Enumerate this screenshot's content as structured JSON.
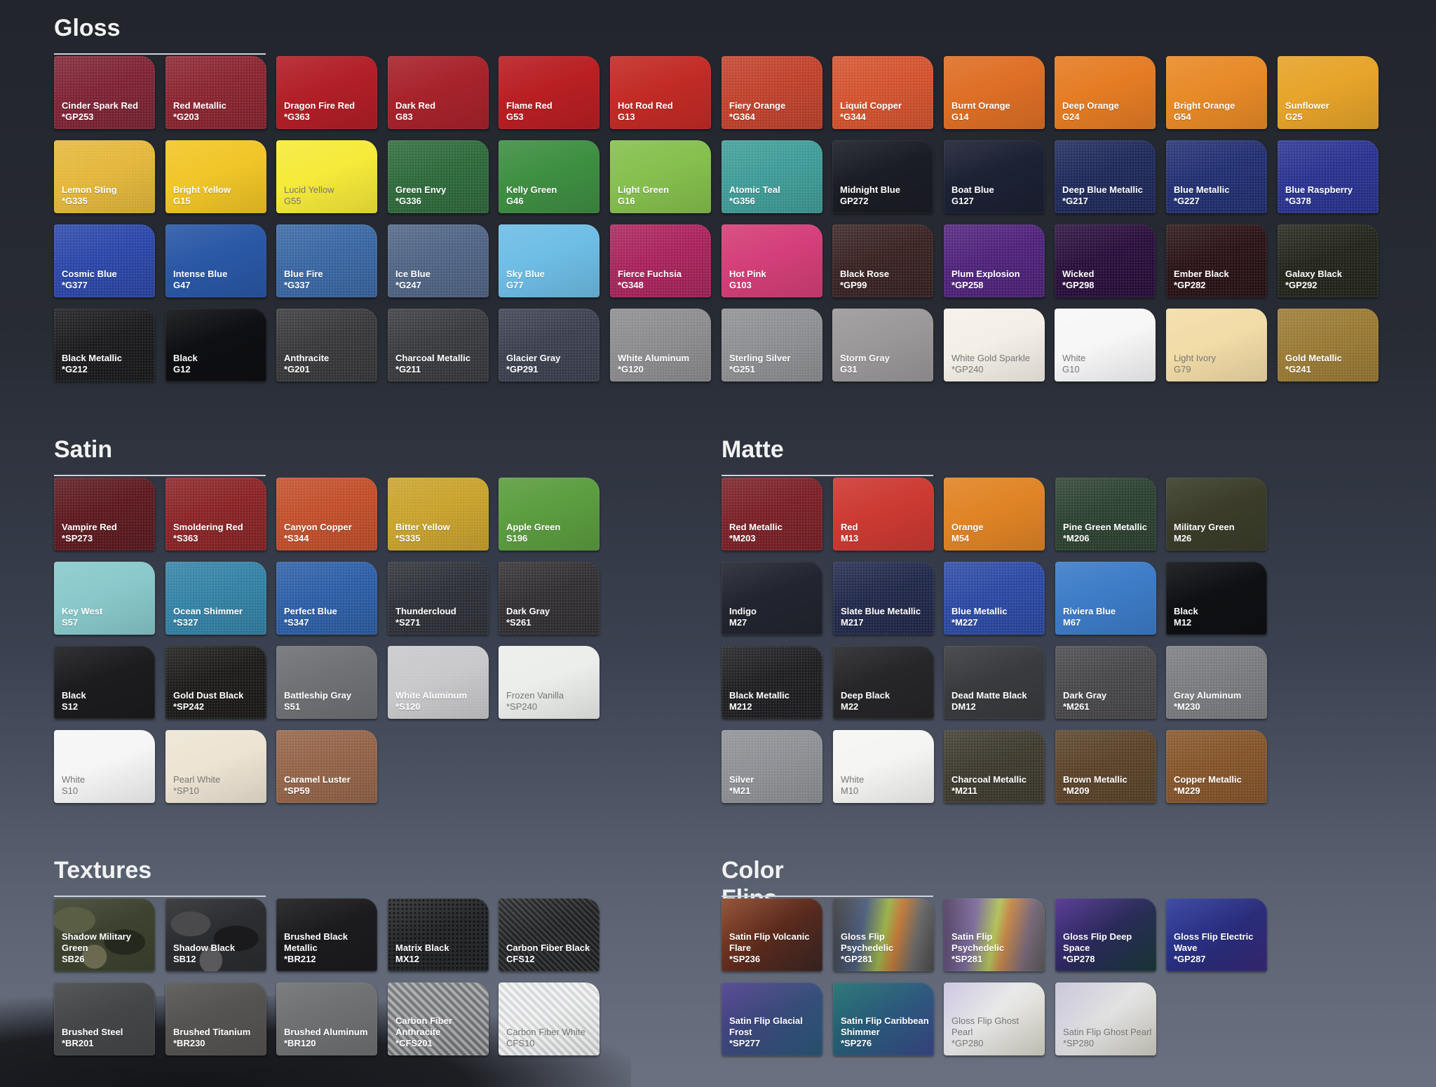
{
  "sections": [
    {
      "title": "Gloss",
      "swatches": [
        {
          "name": "Cinder Spark Red",
          "code": "*GP253",
          "color": "#7e2436",
          "texture": "metal"
        },
        {
          "name": "Red Metallic",
          "code": "*G203",
          "color": "#8a2530",
          "texture": "metal"
        },
        {
          "name": "Dragon Fire Red",
          "code": "*G363",
          "color": "#b21f27"
        },
        {
          "name": "Dark Red",
          "code": "G83",
          "color": "#a8232c"
        },
        {
          "name": "Flame Red",
          "code": "G53",
          "color": "#b91f23"
        },
        {
          "name": "Hot Rod Red",
          "code": "G13",
          "color": "#c32b26"
        },
        {
          "name": "Fiery Orange",
          "code": "*G364",
          "color": "#c0422c",
          "texture": "metal"
        },
        {
          "name": "Liquid Copper",
          "code": "*G344",
          "color": "#d3532e",
          "texture": "metal"
        },
        {
          "name": "Burnt Orange",
          "code": "G14",
          "color": "#de6f26"
        },
        {
          "name": "Deep Orange",
          "code": "G24",
          "color": "#e57c24"
        },
        {
          "name": "Bright Orange",
          "code": "G54",
          "color": "#e88a28"
        },
        {
          "name": "Sunflower",
          "code": "G25",
          "color": "#e6a42a"
        },
        {
          "name": "Lemon Sting",
          "code": "*G335",
          "color": "#e4b73a",
          "texture": "metal"
        },
        {
          "name": "Bright Yellow",
          "code": "G15",
          "color": "#f1c628"
        },
        {
          "name": "Lucid Yellow",
          "code": "G55",
          "color": "#f6ea3a",
          "textStyle": "dark-text"
        },
        {
          "name": "Green Envy",
          "code": "*G336",
          "color": "#2f6a3b",
          "texture": "metal"
        },
        {
          "name": "Kelly Green",
          "code": "G46",
          "color": "#3f8f43"
        },
        {
          "name": "Light Green",
          "code": "G16",
          "color": "#86c04e"
        },
        {
          "name": "Atomic Teal",
          "code": "*G356",
          "color": "#3f9c98",
          "texture": "metal"
        },
        {
          "name": "Midnight Blue",
          "code": "GP272",
          "color": "#1b1d25"
        },
        {
          "name": "Boat Blue",
          "code": "G127",
          "color": "#1c2134"
        },
        {
          "name": "Deep Blue Metallic",
          "code": "*G217",
          "color": "#1f2a5a",
          "texture": "metal"
        },
        {
          "name": "Blue Metallic",
          "code": "*G227",
          "color": "#223072",
          "texture": "metal"
        },
        {
          "name": "Blue Raspberry",
          "code": "*G378",
          "color": "#2a3390",
          "texture": "metal"
        },
        {
          "name": "Cosmic Blue",
          "code": "*G377",
          "color": "#2b47a8",
          "texture": "metal"
        },
        {
          "name": "Intense Blue",
          "code": "G47",
          "color": "#2a58a6"
        },
        {
          "name": "Blue Fire",
          "code": "*G337",
          "color": "#3a67a3",
          "texture": "metal"
        },
        {
          "name": "Ice Blue",
          "code": "*G247",
          "color": "#506585",
          "texture": "metal"
        },
        {
          "name": "Sky Blue",
          "code": "G77",
          "color": "#6ebde5"
        },
        {
          "name": "Fierce Fuchsia",
          "code": "*G348",
          "color": "#a9245c",
          "texture": "metal"
        },
        {
          "name": "Hot Pink",
          "code": "G103",
          "color": "#d43f79"
        },
        {
          "name": "Black Rose",
          "code": "*GP99",
          "color": "#3a2323",
          "texture": "metal"
        },
        {
          "name": "Plum Explosion",
          "code": "*GP258",
          "color": "#4f237b",
          "texture": "metal"
        },
        {
          "name": "Wicked",
          "code": "*GP298",
          "color": "#2a0f3c",
          "texture": "metal"
        },
        {
          "name": "Ember Black",
          "code": "*GP282",
          "color": "#2a1316",
          "texture": "metal"
        },
        {
          "name": "Galaxy Black",
          "code": "*GP292",
          "color": "#24261c",
          "texture": "metal"
        },
        {
          "name": "Black Metallic",
          "code": "*G212",
          "color": "#1b1b1d",
          "texture": "metal"
        },
        {
          "name": "Black",
          "code": "G12",
          "color": "#0e0f12"
        },
        {
          "name": "Anthracite",
          "code": "*G201",
          "color": "#39393b",
          "texture": "metal"
        },
        {
          "name": "Charcoal Metallic",
          "code": "*G211",
          "color": "#3a3b3f",
          "texture": "metal"
        },
        {
          "name": "Glacier Gray",
          "code": "*GP291",
          "color": "#3c4150",
          "texture": "metal"
        },
        {
          "name": "White Aluminum",
          "code": "*G120",
          "color": "#8c8c8e",
          "texture": "metal"
        },
        {
          "name": "Sterling Silver",
          "code": "*G251",
          "color": "#8d8f92",
          "texture": "metal"
        },
        {
          "name": "Storm Gray",
          "code": "G31",
          "color": "#9a9898"
        },
        {
          "name": "White Gold Sparkle",
          "code": "*GP240",
          "color": "#f4efe6",
          "texture": "metal",
          "textStyle": "dark-text"
        },
        {
          "name": "White",
          "code": "G10",
          "color": "#f7f7f7",
          "textStyle": "dark-text"
        },
        {
          "name": "Light Ivory",
          "code": "G79",
          "color": "#f2dca7",
          "textStyle": "dark-text"
        },
        {
          "name": "Gold Metallic",
          "code": "*G241",
          "color": "#9a7a34",
          "texture": "metal"
        }
      ]
    },
    {
      "title": "Satin",
      "swatches": [
        {
          "name": "Vampire Red",
          "code": "*SP273",
          "color": "#5d1a20",
          "texture": "metal"
        },
        {
          "name": "Smoldering Red",
          "code": "*S363",
          "color": "#8a2427",
          "texture": "metal"
        },
        {
          "name": "Canyon Copper",
          "code": "*S344",
          "color": "#c24f2b",
          "texture": "metal"
        },
        {
          "name": "Bitter Yellow",
          "code": "*S335",
          "color": "#c9a22c",
          "texture": "metal"
        },
        {
          "name": "Apple Green",
          "code": "S196",
          "color": "#5c9d40"
        },
        {
          "name": "Key West",
          "code": "S57",
          "color": "#89c9cb"
        },
        {
          "name": "Ocean Shimmer",
          "code": "*S327",
          "color": "#3382a6",
          "texture": "metal"
        },
        {
          "name": "Perfect Blue",
          "code": "*S347",
          "color": "#2d5fa6",
          "texture": "metal"
        },
        {
          "name": "Thundercloud",
          "code": "*S271",
          "color": "#2f3139",
          "texture": "metal"
        },
        {
          "name": "Dark Gray",
          "code": "*S261",
          "color": "#333034",
          "texture": "metal"
        },
        {
          "name": "Black",
          "code": "S12",
          "color": "#1c1b1d"
        },
        {
          "name": "Gold Dust Black",
          "code": "*SP242",
          "color": "#1d1c1a",
          "texture": "metal"
        },
        {
          "name": "Battleship Gray",
          "code": "S51",
          "color": "#6f7175"
        },
        {
          "name": "White Aluminum",
          "code": "*S120",
          "color": "#c8c7c9",
          "texture": "metal"
        },
        {
          "name": "Frozen Vanilla",
          "code": "*SP240",
          "color": "#eceeec",
          "textStyle": "dark-text"
        },
        {
          "name": "White",
          "code": "S10",
          "color": "#f6f6f6",
          "textStyle": "dark-text"
        },
        {
          "name": "Pearl White",
          "code": "*SP10",
          "color": "#ede4d3",
          "textStyle": "dark-text"
        },
        {
          "name": "Caramel Luster",
          "code": "*SP59",
          "color": "#936448",
          "texture": "metal"
        }
      ]
    },
    {
      "title": "Matte",
      "swatches": [
        {
          "name": "Red Metallic",
          "code": "*M203",
          "color": "#7a2127",
          "texture": "metal"
        },
        {
          "name": "Red",
          "code": "M13",
          "color": "#cc3a33"
        },
        {
          "name": "Orange",
          "code": "M54",
          "color": "#e08426"
        },
        {
          "name": "Pine Green Metallic",
          "code": "*M206",
          "color": "#2d4231",
          "texture": "metal"
        },
        {
          "name": "Military Green",
          "code": "M26",
          "color": "#3b3d2a"
        },
        {
          "name": "Indigo",
          "code": "M27",
          "color": "#22252f"
        },
        {
          "name": "Slate Blue Metallic",
          "code": "M217",
          "color": "#22294b",
          "texture": "metal"
        },
        {
          "name": "Blue Metallic",
          "code": "*M227",
          "color": "#2b4aa4",
          "texture": "metal"
        },
        {
          "name": "Riviera Blue",
          "code": "M67",
          "color": "#3d7cc8"
        },
        {
          "name": "Black",
          "code": "M12",
          "color": "#0f1013"
        },
        {
          "name": "Black Metallic",
          "code": "M212",
          "color": "#202022",
          "texture": "metal"
        },
        {
          "name": "Deep Black",
          "code": "M22",
          "color": "#262628"
        },
        {
          "name": "Dead Matte Black",
          "code": "DM12",
          "color": "#3a3b3e"
        },
        {
          "name": "Dark Gray",
          "code": "*M261",
          "color": "#49494b",
          "texture": "metal"
        },
        {
          "name": "Gray Aluminum",
          "code": "*M230",
          "color": "#7b7c80",
          "texture": "metal"
        },
        {
          "name": "Silver",
          "code": "*M21",
          "color": "#8e9095",
          "texture": "metal"
        },
        {
          "name": "White",
          "code": "M10",
          "color": "#f5f5f4",
          "textStyle": "dark-text"
        },
        {
          "name": "Charcoal Metallic",
          "code": "*M211",
          "color": "#3f3b30",
          "texture": "metal"
        },
        {
          "name": "Brown Metallic",
          "code": "*M209",
          "color": "#5b432a",
          "texture": "metal"
        },
        {
          "name": "Copper Metallic",
          "code": "*M229",
          "color": "#85552a",
          "texture": "metal"
        }
      ]
    },
    {
      "title": "Textures",
      "swatches": [
        {
          "name": "Shadow Military Green",
          "code": "SB26",
          "color": "#3d4230",
          "texture": "camo-green"
        },
        {
          "name": "Shadow Black",
          "code": "SB12",
          "color": "#2c2d30",
          "texture": "camo-black"
        },
        {
          "name": "Brushed Black Metallic",
          "code": "*BR212",
          "color": "#17171a",
          "texture": "brushed"
        },
        {
          "name": "Matrix Black",
          "code": "MX12",
          "color": "#2b2c2f",
          "texture": "matrix"
        },
        {
          "name": "Carbon Fiber Black",
          "code": "CFS12",
          "color": "#2a2b2d",
          "texture": "carbon"
        },
        {
          "name": "Brushed Steel",
          "code": "*BR201",
          "color": "#434446",
          "texture": "brushed"
        },
        {
          "name": "Brushed Titanium",
          "code": "*BR230",
          "color": "#545250",
          "texture": "brushed"
        },
        {
          "name": "Brushed Aluminum",
          "code": "*BR120",
          "color": "#6f7072",
          "texture": "brushed"
        },
        {
          "name": "Carbon Fiber Anthracite",
          "code": "*CFS201",
          "color": "#8e8f92",
          "texture": "carbon-light"
        },
        {
          "name": "Carbon Fiber White",
          "code": "CFS10",
          "color": "#e9eaeb",
          "texture": "carbon-white",
          "textStyle": "dark-text"
        }
      ]
    },
    {
      "title": "Color Flips",
      "swatches": [
        {
          "name": "Satin Flip Volcanic Flare",
          "code": "*SP236",
          "color": "#6a3320",
          "gradient": "linear-gradient(135deg,#8a4426 0%,#5c2a1c 50%,#3a2626 100%)"
        },
        {
          "name": "Gloss Flip Psychedelic",
          "code": "*GP281",
          "color": "#6a6a6a",
          "gradient": "linear-gradient(100deg,#3a3a3a 0%,#4a5a7a 30%,#9ab04a 50%,#c27a3a 62%,#6a6a6a 80%,#4a4a4a 100%)"
        },
        {
          "name": "Satin Flip Psychedelic",
          "code": "*SP281",
          "color": "#6a6a6a",
          "gradient": "linear-gradient(100deg,#4a3a5a 0%,#7a6a9a 30%,#b2c25a 50%,#c5864a 60%,#7a6a7a 80%,#5a5a5a 100%)"
        },
        {
          "name": "Gloss Flip Deep Space",
          "code": "*GP278",
          "color": "#2b2758",
          "gradient": "linear-gradient(135deg,#4a2a8a 0%,#2a2a5a 50%,#1a3a3a 100%)"
        },
        {
          "name": "Gloss Flip Electric Wave",
          "code": "*GP287",
          "color": "#273088",
          "gradient": "linear-gradient(135deg,#2a3a9a 0%,#2a2c7a 60%,#3a2a7a 100%)"
        },
        {
          "name": "Satin Flip Glacial Frost",
          "code": "*SP277",
          "color": "#3a4a7a",
          "gradient": "linear-gradient(135deg,#4a3a8a 0%,#3a4a7a 50%,#2a5a7a 100%)"
        },
        {
          "name": "Satin Flip Caribbean Shimmer",
          "code": "*SP276",
          "color": "#2a5a6a",
          "gradient": "linear-gradient(135deg,#1a6a6a 0%,#2a5a7a 50%,#3a4a8a 100%)"
        },
        {
          "name": "Gloss Flip Ghost Pearl",
          "code": "*GP280",
          "color": "#d9d6e2",
          "gradient": "linear-gradient(135deg,#c9c2e0 0%,#e8e8e8 45%,#d8d6c8 100%)",
          "textStyle": "dark-text"
        },
        {
          "name": "Satin Flip Ghost Pearl",
          "code": "*SP280",
          "color": "#d4d2da",
          "gradient": "linear-gradient(135deg,#c6c2d8 0%,#e2e2e2 50%,#d2d0c4 100%)",
          "textStyle": "dark-text"
        }
      ]
    }
  ]
}
